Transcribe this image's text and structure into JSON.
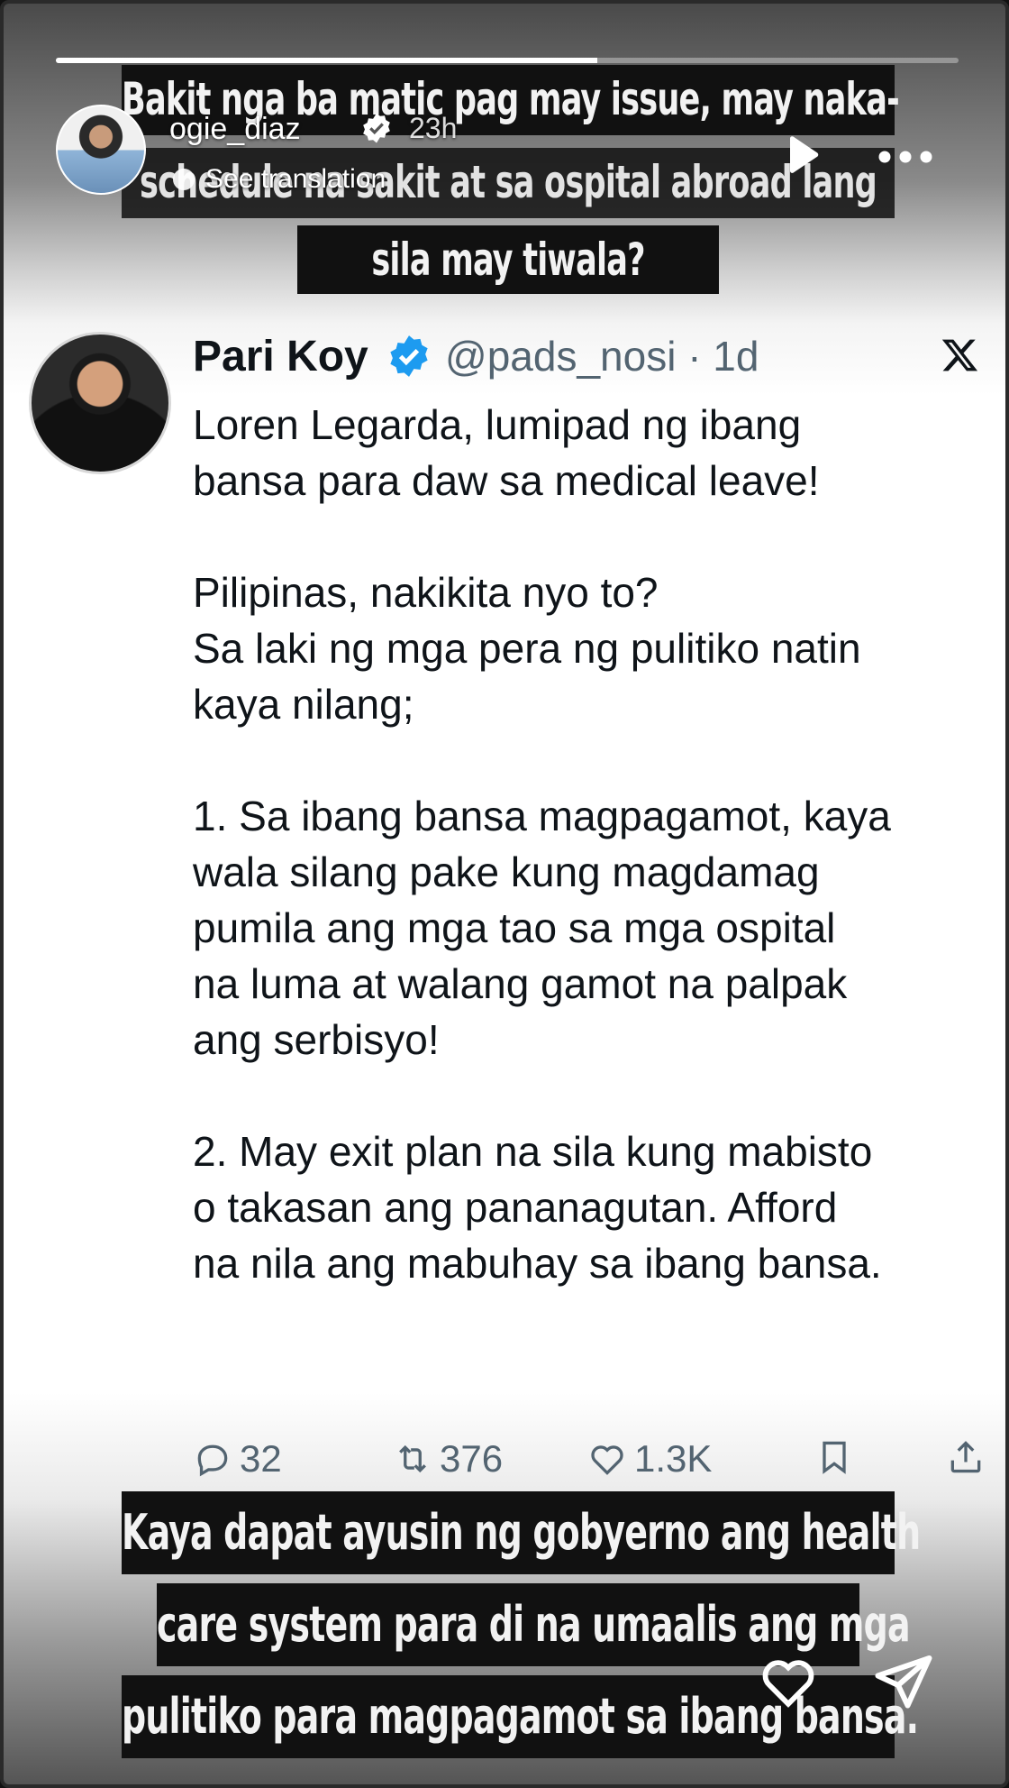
{
  "story": {
    "progress": 0.6,
    "username": "ogie_diaz",
    "time": "23h",
    "see_translation": "See translation",
    "icons": [
      "verified-icon",
      "play-icon",
      "more-icon",
      "heart-icon",
      "send-icon"
    ]
  },
  "captions": {
    "top": [
      "Bakit nga ba matic pag may issue, may naka-",
      "schedule na sakit at sa ospital abroad lang",
      "sila may tiwala?"
    ],
    "bottom": [
      "Kaya dapat ayusin ng gobyerno ang health",
      "care system para di na umaalis ang mga",
      "pulitiko para magpagamot sa ibang bansa."
    ]
  },
  "tweet": {
    "name": "Pari Koy",
    "handle_time": "@pads_nosi · 1d",
    "body": "Loren Legarda, lumipad ng ibang\nbansa para daw sa medical leave!\n\nPilipinas, nakikita nyo to?\nSa laki ng mga pera ng pulitiko natin\nkaya nilang;\n\n1. Sa ibang bansa magpagamot, kaya\nwala silang pake kung magdamag\npumila ang mga tao sa mga ospital\nna luma at walang gamot na palpak\nang serbisyo!\n\n2. May exit plan na sila kung mabisto\no takasan ang pananagutan. Afford\nna nila ang mabuhay sa ibang bansa.",
    "replies": "32",
    "reposts": "376",
    "likes": "1.3K",
    "colors": {
      "text": "#0f1419",
      "secondary": "#536471",
      "verified": "#1d9bf0"
    }
  }
}
